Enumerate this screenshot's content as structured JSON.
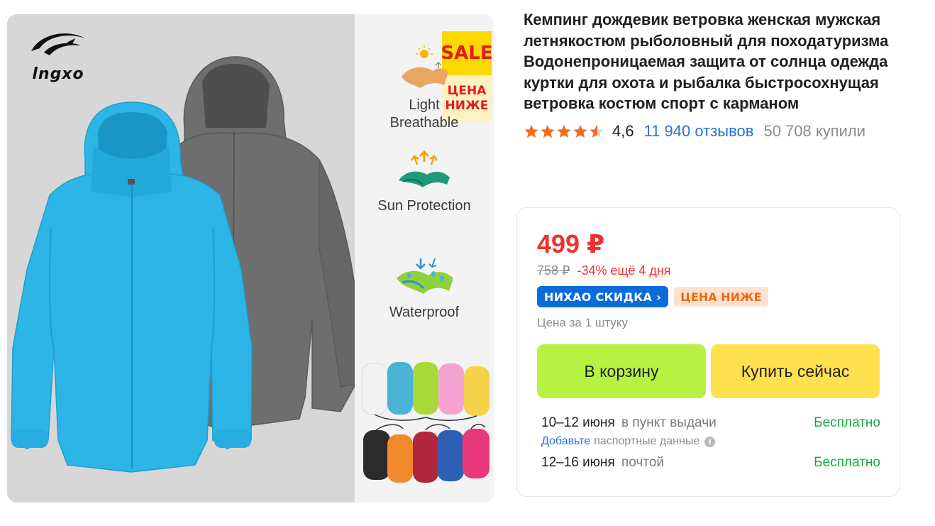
{
  "product_image": {
    "brand_logo_text": "lngxo",
    "sale_badge": {
      "top": "SALE",
      "bottom_line1": "ЦЕНА",
      "bottom_line2": "НИЖЕ"
    },
    "features": [
      {
        "label_line1": "Light",
        "label_line2": "Breathable",
        "icon": "sun-fabric-icon"
      },
      {
        "label_line1": "Sun Protection",
        "label_line2": "",
        "icon": "fabric-arrows-icon"
      },
      {
        "label_line1": "Waterproof",
        "label_line2": "",
        "icon": "water-drops-fabric-icon"
      }
    ],
    "colors": {
      "jacket_front": "#2cb5e6",
      "jacket_back": "#6b6b6b",
      "bags": [
        "#f2f2f2",
        "#4ab3d6",
        "#a9d938",
        "#f4a3d0",
        "#f5d24a",
        "#2b2b2b",
        "#f08a2c",
        "#b0263c",
        "#2f5fb5",
        "#e8397a"
      ]
    }
  },
  "product": {
    "title": "Кемпинг дождевик ветровка женская мужская летнякостюм рыболовный для походатуризма Водонепроницаемая защита от солнца одежда куртки для охота и рыбалка быстросохнущая ветровка костюм спорт с карманом",
    "rating": "4,6",
    "rating_stars": 4.5,
    "reviews": "11 940 отзывов",
    "bought": "50 708 купили"
  },
  "price_card": {
    "price": "499 ₽",
    "old_price": "758 ₽",
    "discount": "-34% ещё 4 дня",
    "badge_primary": "НИХАО СКИДКА",
    "badge_secondary": "ЦЕНА НИЖЕ",
    "unit_price": "Цена за 1 штуку",
    "add_to_cart": "В корзину",
    "buy_now": "Купить сейчас",
    "delivery": [
      {
        "date": "10–12 июня",
        "method": "в пункт выдачи",
        "cost": "Бесплатно"
      },
      {
        "date": "12–16 июня",
        "method": "почтой",
        "cost": "Бесплатно"
      }
    ],
    "passport_link": "Добавьте",
    "passport_text": "паспортные данные",
    "info_glyph": "i",
    "colors": {
      "price": "#f0302f",
      "free": "#1aa844",
      "cart_button": "#b7f243",
      "buy_button": "#ffe14f",
      "link": "#2a6fdb"
    }
  }
}
